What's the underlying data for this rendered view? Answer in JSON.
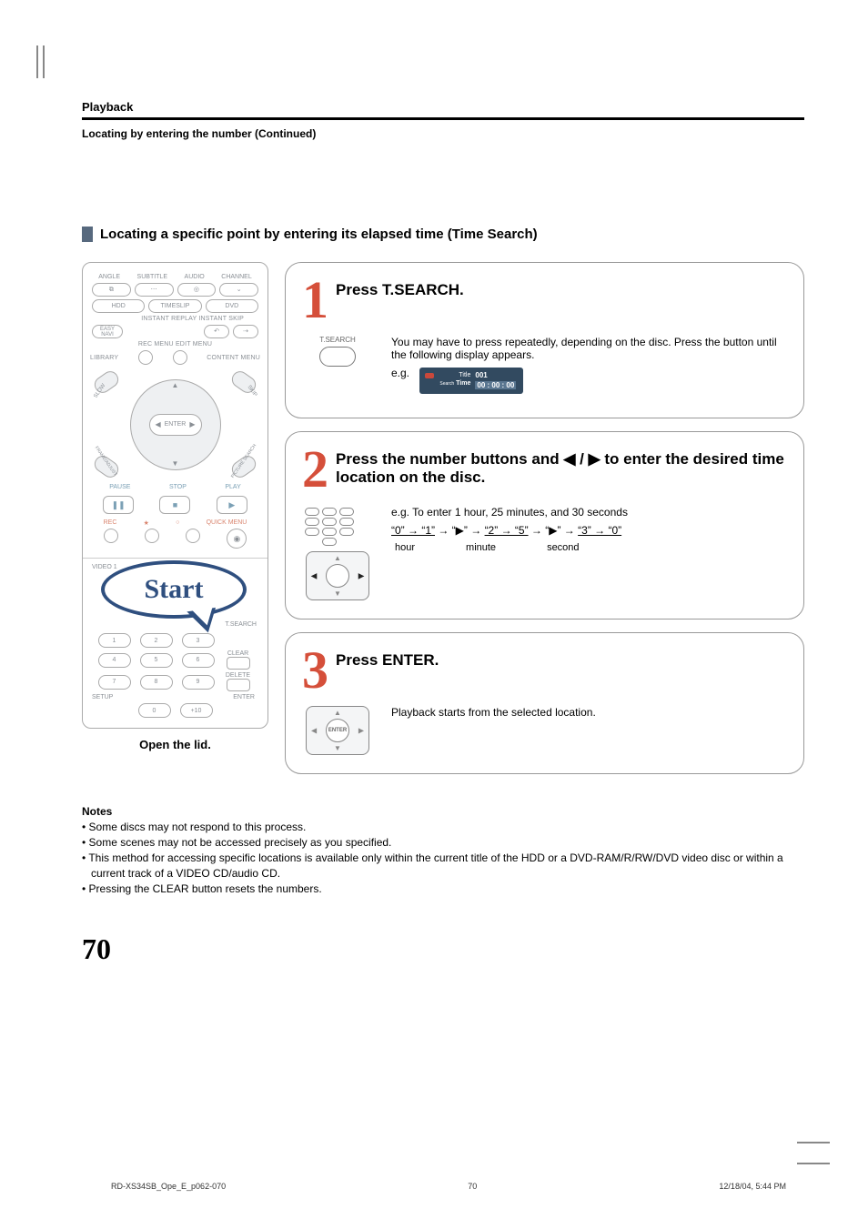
{
  "header": {
    "section": "Playback",
    "continued": "Locating by entering the number (Continued)",
    "subheading": "Locating a specific point by entering its elapsed time (Time Search)"
  },
  "remote": {
    "row1_labels": [
      "ANGLE",
      "SUBTITLE",
      "AUDIO",
      "CHANNEL"
    ],
    "row2_labels": [
      "HDD",
      "TIMESLIP",
      "DVD"
    ],
    "row3_top": "INSTANT REPLAY  INSTANT SKIP",
    "row3_left": "EASY\nNAVI",
    "row4_labels": "REC MENU   EDIT MENU",
    "row4_left": "LIBRARY",
    "row4_right": "CONTENT MENU",
    "dpad_center": "ENTER",
    "dpad_corner_tl": "SLOW",
    "dpad_corner_tr": "SKIP",
    "dpad_corner_bl": "FRAME/ADJUST",
    "dpad_corner_br": "PICTURE SEARCH",
    "play_labels": [
      "PAUSE",
      "STOP",
      "PLAY"
    ],
    "rec_labels_left": "REC",
    "rec_labels_right": "QUICK MENU",
    "video_label": "VIDEO 1",
    "start_bubble": "Start",
    "tsearch_label": "T.SEARCH",
    "numpad": [
      [
        "1",
        "2",
        "3"
      ],
      [
        "4",
        "5",
        "6"
      ],
      [
        "7",
        "8",
        "9"
      ],
      [
        "0",
        "+10"
      ]
    ],
    "side_labels": [
      "CLEAR",
      "DELETE"
    ],
    "bottom_left": "SETUP",
    "bottom_right": "ENTER",
    "open_lid": "Open the lid."
  },
  "steps": [
    {
      "num": "1",
      "title": "Press T.SEARCH.",
      "icon_label": "T.SEARCH",
      "body": "You may have to press repeatedly, depending on the disc. Press the button until the following display appears.",
      "eg_label": "e.g.",
      "osd_title_lbl": "Title",
      "osd_title_val": "001",
      "osd_time_lbl": "Time",
      "osd_time_val": "00 : 00 : 00",
      "osd_search": "Search"
    },
    {
      "num": "2",
      "title_pre": "Press the number buttons and ",
      "title_mid": " / ",
      "title_post": " to enter the desired time location on the disc.",
      "example_intro": "e.g. To enter 1 hour, 25 minutes, and 30 seconds",
      "sequence": "“0” → “1” → “▶” → “2” → “5” → “▶” → “3” → “0”",
      "seq_labels": [
        "hour",
        "minute",
        "second"
      ]
    },
    {
      "num": "3",
      "title": "Press ENTER.",
      "dpad_center": "ENTER",
      "body": "Playback starts from the selected location."
    }
  ],
  "notes": {
    "heading": "Notes",
    "items": [
      "Some discs may not respond to this process.",
      "Some scenes may not be accessed precisely as you specified.",
      "This method for accessing specific locations is available only within the current title of the HDD or a DVD-RAM/R/RW/DVD video disc or within a current track of a VIDEO CD/audio CD.",
      "Pressing the CLEAR button resets the numbers."
    ]
  },
  "page_number": "70",
  "footer": {
    "left": "RD-XS34SB_Ope_E_p062-070",
    "center": "70",
    "right": "12/18/04, 5:44 PM"
  }
}
